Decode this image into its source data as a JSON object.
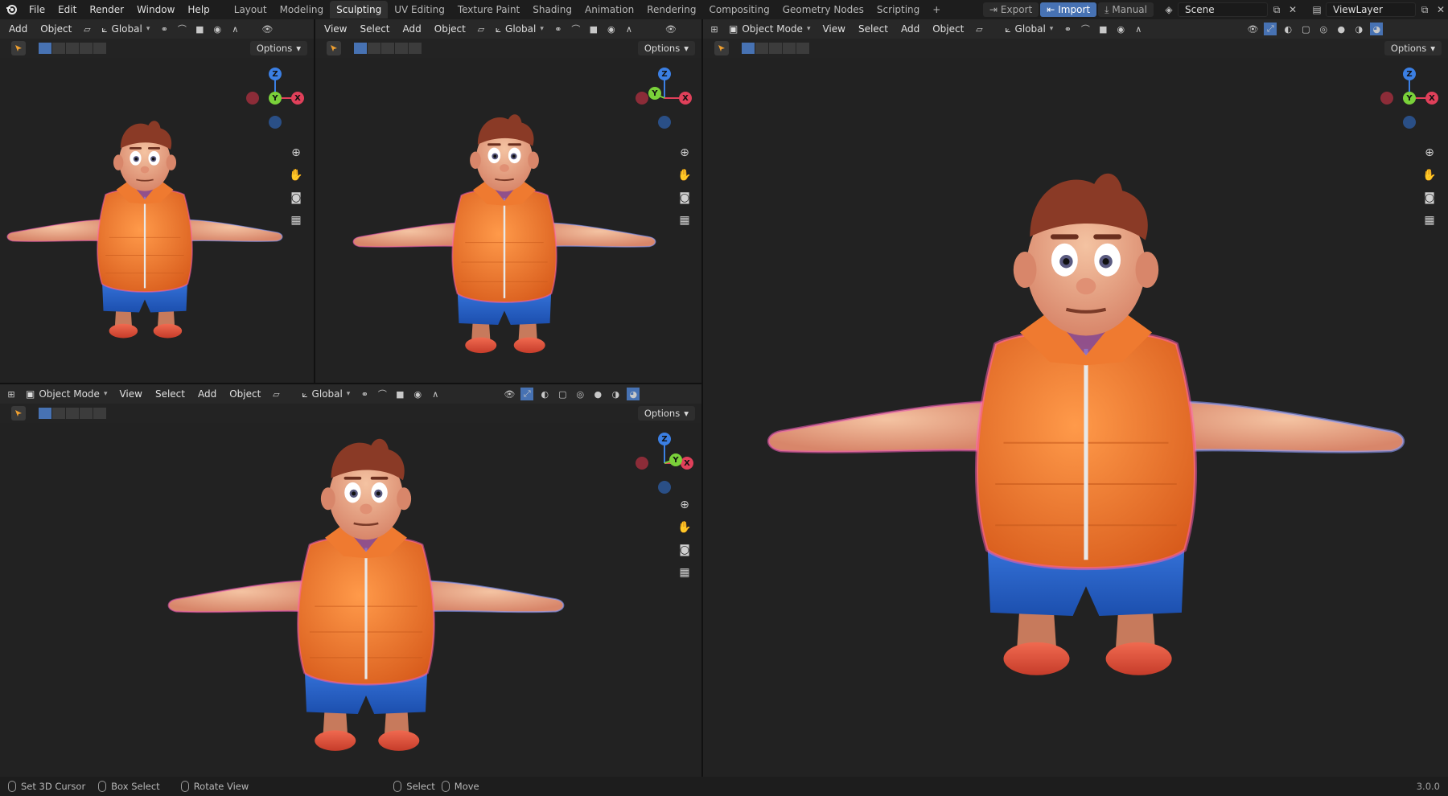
{
  "menu": [
    "File",
    "Edit",
    "Render",
    "Window",
    "Help"
  ],
  "workspaces": {
    "tabs": [
      "Layout",
      "Modeling",
      "Sculpting",
      "UV Editing",
      "Texture Paint",
      "Shading",
      "Animation",
      "Rendering",
      "Compositing",
      "Geometry Nodes",
      "Scripting"
    ],
    "active": "Sculpting",
    "add": "+"
  },
  "topright": {
    "export": "Export",
    "import": "Import",
    "manual": "Manual",
    "scene": "Scene",
    "viewlayer": "ViewLayer"
  },
  "viewports": {
    "top_left": {
      "header": [
        "Add",
        "Object"
      ],
      "transform": "Global",
      "options": "Options"
    },
    "top_mid": {
      "header": [
        "View",
        "Select",
        "Add",
        "Object"
      ],
      "transform": "Global",
      "options": "Options"
    },
    "right": {
      "mode": "Object Mode",
      "header": [
        "View",
        "Select",
        "Add",
        "Object"
      ],
      "transform": "Global",
      "options": "Options"
    },
    "bottom_left": {
      "mode": "Object Mode",
      "header": [
        "View",
        "Select",
        "Add",
        "Object"
      ],
      "transform": "Global",
      "options": "Options"
    }
  },
  "gizmo": {
    "x": "X",
    "y": "Y",
    "z": "Z"
  },
  "status": {
    "items": [
      "Set 3D Cursor",
      "Box Select",
      "Rotate View",
      "Select",
      "Move"
    ],
    "version": "3.0.0"
  },
  "colors": {
    "accent": "#4772b3",
    "vest": "#f07a2a",
    "shorts": "#2a63c9",
    "skin": "#e8a27e",
    "rim": "#e85ab0"
  }
}
